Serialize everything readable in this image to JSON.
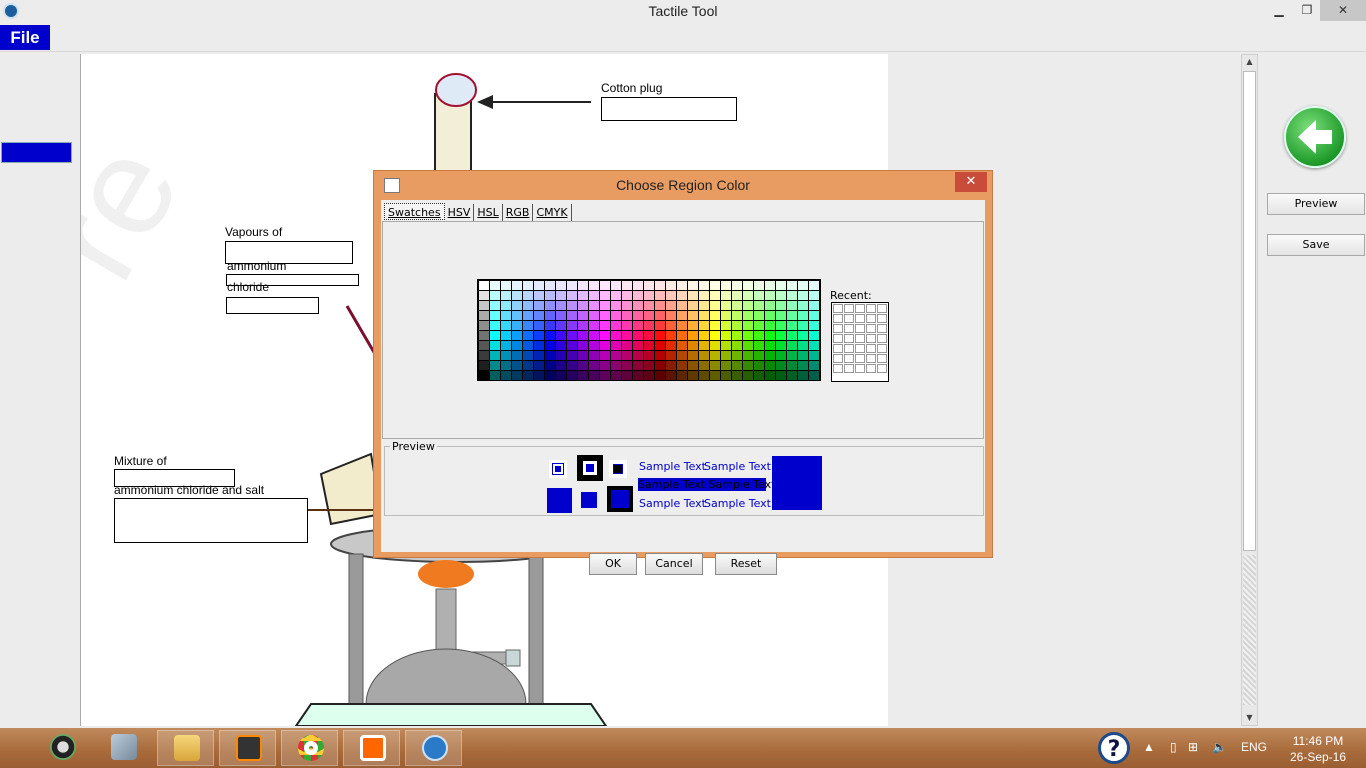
{
  "window": {
    "title": "Tactile Tool",
    "minimize": "▁",
    "maximize": "❐",
    "close": "✕"
  },
  "menu": {
    "file": "File"
  },
  "canvas": {
    "labels": {
      "cotton_plug": "Cotton plug",
      "vapours_of": "Vapours of",
      "ammonium": "ammonium",
      "chloride": "chloride",
      "mixture_of": "Mixture of",
      "ammonium_chloride_and_salt": "ammonium chloride and salt"
    }
  },
  "right_panel": {
    "preview": "Preview",
    "save": "Save",
    "back_icon": "back-arrow-icon"
  },
  "dialog": {
    "title": "Choose Region Color",
    "close": "✕",
    "tabs": [
      "Swatches",
      "HSV",
      "HSL",
      "RGB",
      "CMYK"
    ],
    "active_tab": "Swatches",
    "recent_label": "Recent:",
    "preview_label": "Preview",
    "sample_text": "Sample Text",
    "selected_color": "#0000cc",
    "buttons": {
      "ok": "OK",
      "cancel": "Cancel",
      "reset": "Reset"
    }
  },
  "taskbar": {
    "apps": [
      "camera-app-icon",
      "cube-app-icon",
      "file-explorer-icon",
      "sublime-text-icon",
      "chrome-icon",
      "media-player-icon",
      "tactile-tool-icon"
    ],
    "language": "ENG",
    "time": "11:46 PM",
    "date": "26-Sep-16"
  }
}
